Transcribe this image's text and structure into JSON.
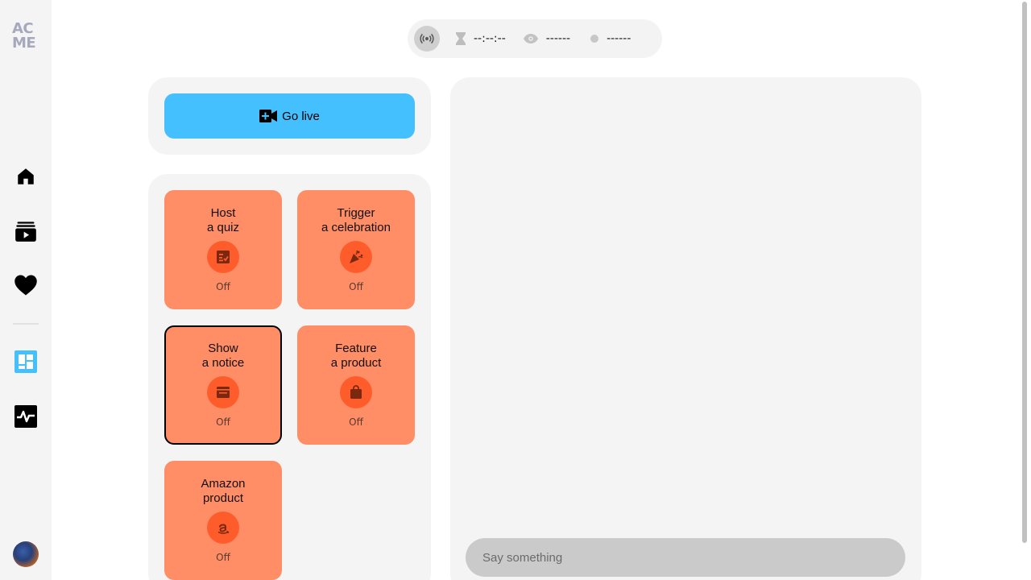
{
  "brand": {
    "logo_line1": "AC",
    "logo_line2": "ME"
  },
  "sidebar": {
    "items": [
      {
        "name": "home",
        "icon": "home-icon"
      },
      {
        "name": "videos",
        "icon": "video-library-icon"
      },
      {
        "name": "favorites",
        "icon": "heart-icon"
      },
      {
        "name": "dashboard",
        "icon": "dashboard-icon",
        "active": true
      },
      {
        "name": "activity",
        "icon": "activity-icon"
      }
    ]
  },
  "status": {
    "timer": "--:--:--",
    "viewers": "------",
    "state": "------"
  },
  "go_live": {
    "label": "Go live"
  },
  "features": [
    {
      "title_line1": "Host",
      "title_line2": "a quiz",
      "status": "Off",
      "icon": "quiz-icon"
    },
    {
      "title_line1": "Trigger",
      "title_line2": "a celebration",
      "status": "Off",
      "icon": "celebration-icon"
    },
    {
      "title_line1": "Show",
      "title_line2": "a notice",
      "status": "Off",
      "icon": "notice-icon",
      "selected": true
    },
    {
      "title_line1": "Feature",
      "title_line2": "a product",
      "status": "Off",
      "icon": "shopping-bag-icon"
    },
    {
      "title_line1": "Amazon",
      "title_line2": "product",
      "status": "Off",
      "icon": "amazon-icon"
    }
  ],
  "chat": {
    "placeholder": "Say something"
  },
  "colors": {
    "accent": "#44c0ff",
    "card": "#ff8d66",
    "card_icon_bg": "#ff5c2b",
    "panel": "#f4f4f4"
  }
}
